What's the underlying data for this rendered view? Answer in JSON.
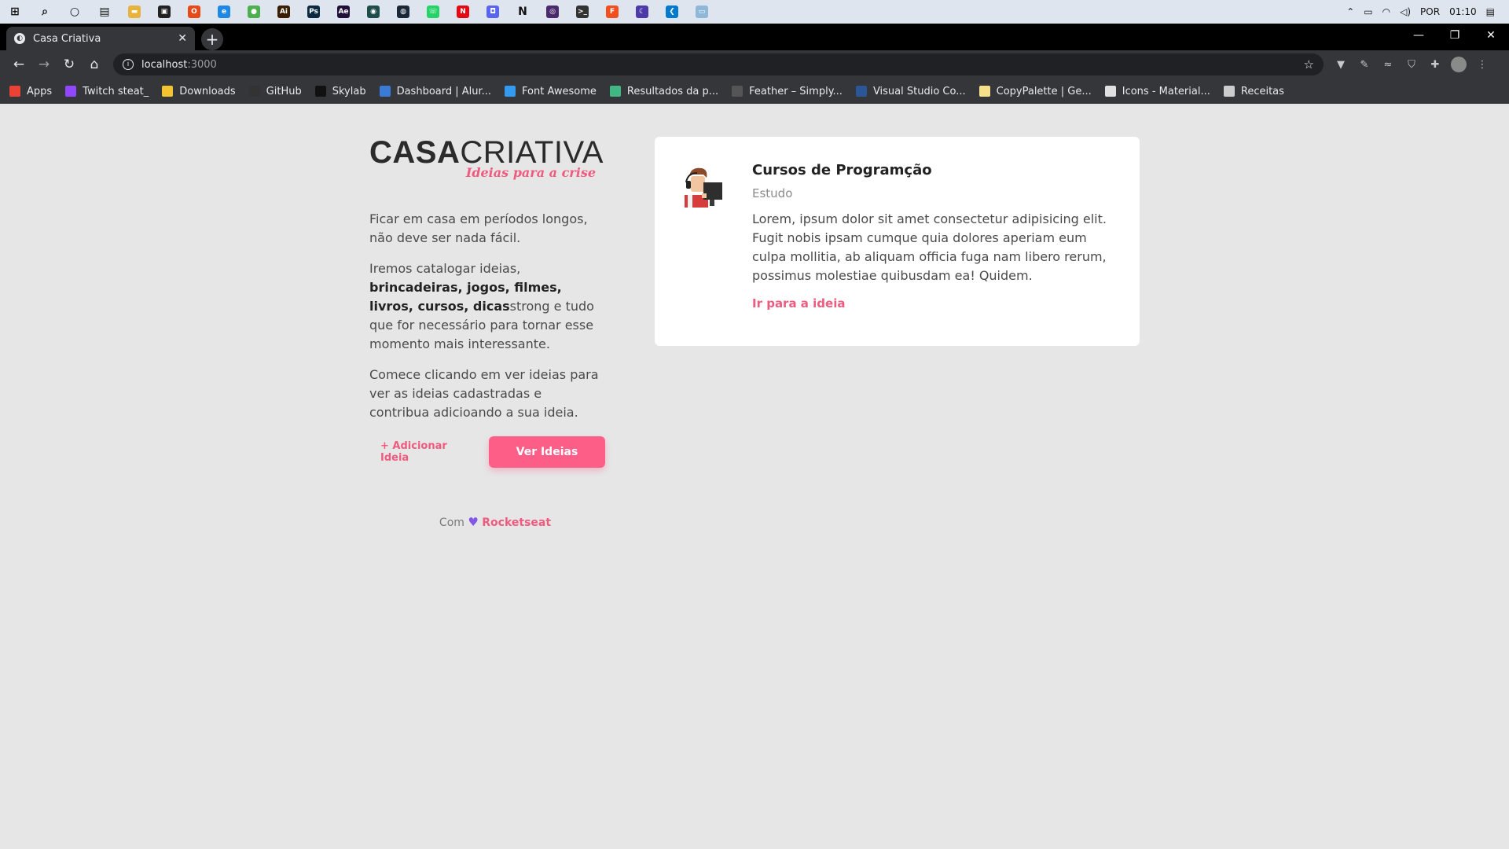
{
  "taskbar": {
    "apps": [
      {
        "name": "windows-start-icon",
        "glyph": "⊞",
        "color": "#000000"
      },
      {
        "name": "search-icon",
        "glyph": "⌕",
        "color": "#000000"
      },
      {
        "name": "cortana-icon",
        "glyph": "○",
        "color": "#000000"
      },
      {
        "name": "task-view-icon",
        "glyph": "▤",
        "color": "#000000"
      },
      {
        "name": "file-explorer-icon",
        "glyph": "▬",
        "color": "#e8b33c"
      },
      {
        "name": "store-icon",
        "glyph": "▣",
        "color": "#222222"
      },
      {
        "name": "office-icon",
        "glyph": "O",
        "color": "#e64a19"
      },
      {
        "name": "edge-icon",
        "glyph": "e",
        "color": "#1e88e5"
      },
      {
        "name": "chrome-icon",
        "glyph": "●",
        "color": "#4caf50"
      },
      {
        "name": "illustrator-icon",
        "glyph": "Ai",
        "color": "#3a1e00"
      },
      {
        "name": "photoshop-icon",
        "glyph": "Ps",
        "color": "#0b2942"
      },
      {
        "name": "after-effects-icon",
        "glyph": "Ae",
        "color": "#1f0f3a"
      },
      {
        "name": "app-circle-icon",
        "glyph": "◉",
        "color": "#1f4e4a"
      },
      {
        "name": "steam-icon",
        "glyph": "◍",
        "color": "#1b2838"
      },
      {
        "name": "whatsapp-icon",
        "glyph": "☏",
        "color": "#25d366"
      },
      {
        "name": "netflix-icon",
        "glyph": "N",
        "color": "#e50914"
      },
      {
        "name": "discord-icon",
        "glyph": "◘",
        "color": "#5865f2"
      },
      {
        "name": "notion-icon",
        "glyph": "N",
        "color": "#ffffff"
      },
      {
        "name": "obs-icon",
        "glyph": "◎",
        "color": "#4a2a6a"
      },
      {
        "name": "terminal-icon",
        "glyph": ">_",
        "color": "#333333"
      },
      {
        "name": "figma-icon",
        "glyph": "F",
        "color": "#f24e1e"
      },
      {
        "name": "app-moon-icon",
        "glyph": "☾",
        "color": "#4b3aa8"
      },
      {
        "name": "vscode-icon",
        "glyph": "❮",
        "color": "#007acc"
      },
      {
        "name": "notes-icon",
        "glyph": "▭",
        "color": "#8fb8d8"
      }
    ],
    "tray": {
      "lang": "POR",
      "time": "01:10"
    }
  },
  "browser": {
    "tab_title": "Casa Criativa",
    "url_host": "localhost",
    "url_port": ":3000",
    "bookmarks": [
      {
        "label": "Apps",
        "icon": "apps-grid-icon",
        "color": "#ea4335"
      },
      {
        "label": "Twitch steat_",
        "icon": "twitch-icon",
        "color": "#9146ff"
      },
      {
        "label": "Downloads",
        "icon": "folder-icon",
        "color": "#f4c430"
      },
      {
        "label": "GitHub",
        "icon": "github-icon",
        "color": "#333333"
      },
      {
        "label": "Skylab",
        "icon": "skylab-icon",
        "color": "#111111"
      },
      {
        "label": "Dashboard | Alur...",
        "icon": "alura-icon",
        "color": "#3a7bd5"
      },
      {
        "label": "Font Awesome",
        "icon": "flag-icon",
        "color": "#339af0"
      },
      {
        "label": "Resultados da p...",
        "icon": "vue-icon",
        "color": "#41b883"
      },
      {
        "label": "Feather – Simply...",
        "icon": "feather-icon",
        "color": "#555555"
      },
      {
        "label": "Visual Studio Co...",
        "icon": "word-icon",
        "color": "#2b579a"
      },
      {
        "label": "CopyPalette | Ge...",
        "icon": "palette-icon",
        "color": "#f7e08a"
      },
      {
        "label": "Icons - Material...",
        "icon": "material-icon",
        "color": "#e0e0e0"
      },
      {
        "label": "Receitas",
        "icon": "chrome-icon",
        "color": "#cccccc"
      }
    ]
  },
  "page": {
    "logo_casa": "CASA",
    "logo_criativa": "CRIATIVA",
    "logo_tagline": "Ideias para a crise",
    "intro_p1": "Ficar em casa em períodos longos, não deve ser nada fácil.",
    "intro_p2_pre": "Iremos catalogar ideias, ",
    "intro_p2_bold": "brincadeiras, jogos, filmes, livros, cursos, dicas",
    "intro_p2_post": "strong e tudo que for necessário para tornar esse momento mais interessante.",
    "intro_p3": "Comece clicando em ver ideias para ver as ideias cadastradas e contribua adicioando a sua ideia.",
    "add_idea_label": "+ Adicionar Ideia",
    "view_ideas_label": "Ver Ideias",
    "footer_pre": "Com",
    "footer_brand": "Rocketseat",
    "card": {
      "title": "Cursos de Programção",
      "category": "Estudo",
      "description": "Lorem, ipsum dolor sit amet consectetur adipisicing elit. Fugit nobis ipsam cumque quia dolores aperiam eum culpa mollitia, ab aliquam officia fuga nam libero rerum, possimus molestiae quibusdam ea! Quidem.",
      "link_label": "Ir para a ideia"
    }
  },
  "colors": {
    "accent": "#fd5e88",
    "link": "#ee5b7e",
    "heart": "#8257e6",
    "background": "#e6e6e6"
  }
}
